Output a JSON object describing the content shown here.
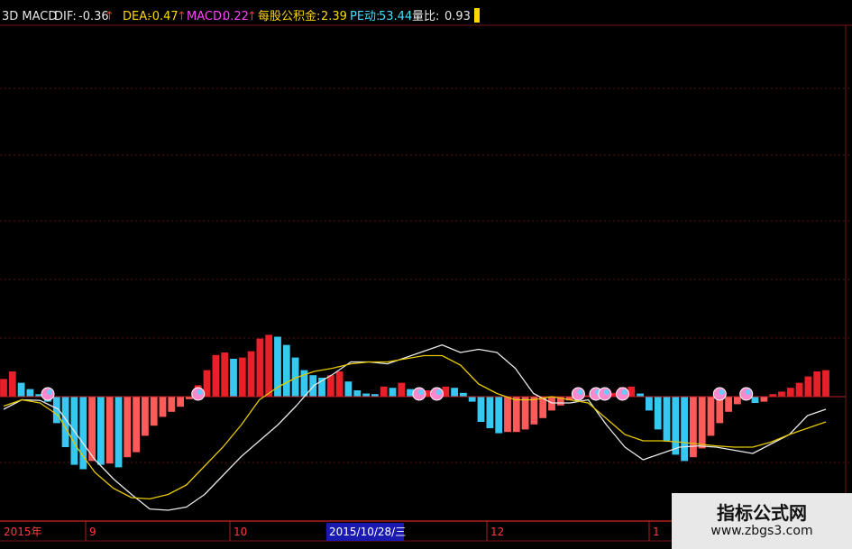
{
  "header": {
    "indicator_name": "3D MACD",
    "dif_label": "DIF:",
    "dif_value": "-0.36",
    "dea_label": "DEA:",
    "dea_value": "-0.47",
    "macd_label": "MACD:",
    "macd_value": "0.22",
    "reserve_label": "每股公积金:",
    "reserve_value": "2.39",
    "pe_label": "PE动:",
    "pe_value": "53.44",
    "ratio_label": "量比:",
    "ratio_value": "0.93",
    "colors": {
      "name": "#e6e6e6",
      "dif": "#e6e6e6",
      "dea": "#ffd700",
      "macd": "#ff44ff",
      "reserve": "#ffd700",
      "pe": "#44ddff",
      "ratio": "#e6e6e6",
      "arrow": "#ff3333"
    }
  },
  "x_axis": {
    "labels": [
      "2015年",
      "9",
      "10",
      "2015/10/28/三",
      "12",
      "1"
    ],
    "highlighted": "2015/10/28/三"
  },
  "watermark": {
    "line1": "指标公式网",
    "line2": "www.zbgs3.com"
  },
  "chart_data": {
    "type": "bar",
    "title": "3D MACD",
    "xlabel": "",
    "ylabel": "",
    "ylim": [
      -1.3,
      1.3
    ],
    "grid": true,
    "legend": "none",
    "colors": {
      "positive_rising": "#e8202a",
      "positive_falling": "#36c8f0",
      "negative_falling": "#36c8f0",
      "negative_rising": "#ff5a5a",
      "dif_line": "#e8e8e8",
      "dea_line": "#e6c800",
      "marker": "#ff88cc",
      "grid": "#8b1a1a",
      "zero": "#bb2222"
    },
    "series": [
      {
        "name": "MACD",
        "kind": "bar",
        "values": [
          0.28,
          0.4,
          0.22,
          0.12,
          0.04,
          -0.08,
          -0.42,
          -0.8,
          -1.08,
          -1.15,
          -1.02,
          -1.08,
          -1.06,
          -1.12,
          -0.96,
          -0.88,
          -0.62,
          -0.46,
          -0.32,
          -0.24,
          -0.16,
          -0.04,
          0.18,
          0.42,
          0.66,
          0.7,
          0.6,
          0.62,
          0.72,
          0.92,
          0.98,
          0.95,
          0.82,
          0.62,
          0.42,
          0.34,
          0.3,
          0.34,
          0.4,
          0.24,
          0.1,
          0.05,
          0.04,
          0.16,
          0.14,
          0.22,
          0.12,
          0.06,
          0.1,
          0.14,
          0.16,
          0.14,
          0.06,
          -0.08,
          -0.4,
          -0.5,
          -0.58,
          -0.56,
          -0.56,
          -0.52,
          -0.44,
          -0.34,
          -0.22,
          -0.14,
          -0.06,
          -0.02,
          0.02,
          0.05,
          0.04,
          0.06,
          0.15,
          0.16,
          0.05,
          -0.22,
          -0.52,
          -0.7,
          -0.92,
          -1.02,
          -0.96,
          -0.82,
          -0.62,
          -0.42,
          -0.24,
          -0.12,
          -0.04,
          -0.1,
          -0.08,
          0.04,
          0.08,
          0.14,
          0.22,
          0.32,
          0.4,
          0.42
        ]
      },
      {
        "name": "DIF",
        "kind": "line",
        "values": [
          -0.2,
          -0.05,
          -0.06,
          -0.2,
          -0.6,
          -1.0,
          -1.3,
          -1.55,
          -1.78,
          -1.8,
          -1.75,
          -1.55,
          -1.25,
          -0.95,
          -0.7,
          -0.45,
          -0.15,
          0.18,
          0.35,
          0.55,
          0.55,
          0.52,
          0.62,
          0.72,
          0.82,
          0.7,
          0.75,
          0.7,
          0.45,
          0.05,
          -0.1,
          -0.1,
          -0.05,
          -0.45,
          -0.8,
          -1.0,
          -0.9,
          -0.8,
          -0.78,
          -0.8,
          -0.85,
          -0.9,
          -0.75,
          -0.6,
          -0.3,
          -0.2
        ]
      },
      {
        "name": "DEA",
        "kind": "line",
        "values": [
          -0.15,
          -0.05,
          -0.1,
          -0.3,
          -0.8,
          -1.2,
          -1.45,
          -1.6,
          -1.62,
          -1.55,
          -1.4,
          -1.1,
          -0.8,
          -0.45,
          -0.05,
          0.15,
          0.3,
          0.4,
          0.45,
          0.52,
          0.55,
          0.55,
          0.6,
          0.65,
          0.65,
          0.5,
          0.2,
          0.05,
          -0.05,
          -0.05,
          0.0,
          -0.05,
          -0.1,
          -0.35,
          -0.6,
          -0.7,
          -0.7,
          -0.72,
          -0.75,
          -0.78,
          -0.8,
          -0.8,
          -0.72,
          -0.6,
          -0.5,
          -0.4
        ]
      }
    ],
    "markers_at_bar_index": [
      5,
      22,
      47,
      49,
      65,
      67,
      68,
      70,
      81,
      84
    ]
  }
}
